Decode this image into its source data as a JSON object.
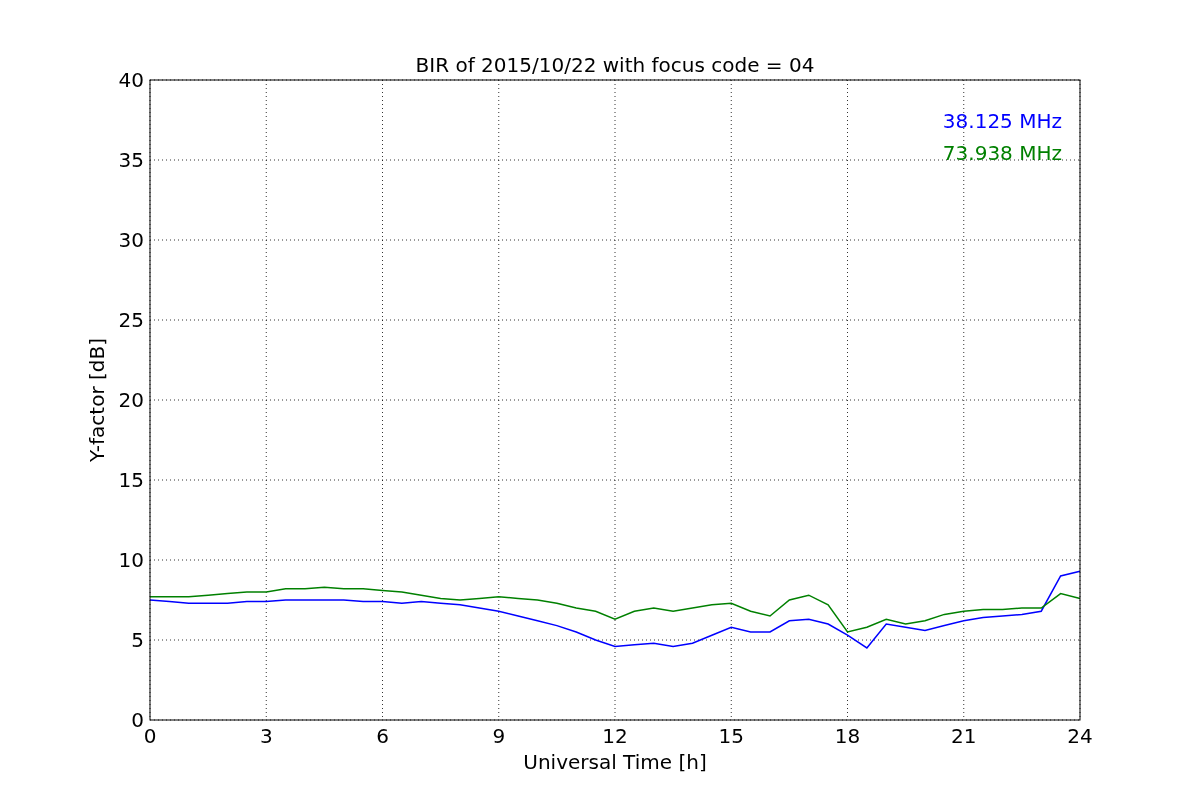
{
  "chart_data": {
    "type": "line",
    "grid": true,
    "title": "BIR of 2015/10/22 with focus code = 04",
    "xlabel": "Universal Time [h]",
    "ylabel": "Y-factor [dB]",
    "x": [
      0,
      0.5,
      1,
      1.5,
      2,
      2.5,
      3,
      3.5,
      4,
      4.5,
      5,
      5.5,
      6,
      6.5,
      7,
      7.5,
      8,
      8.5,
      9,
      9.5,
      10,
      10.5,
      11,
      11.5,
      12,
      12.5,
      13,
      13.5,
      14,
      14.5,
      15,
      15.5,
      16,
      16.5,
      17,
      17.5,
      18,
      18.5,
      19,
      19.5,
      20,
      20.5,
      21,
      21.5,
      22,
      22.5,
      23,
      23.5,
      24
    ],
    "series": [
      {
        "name": "38.125 MHz",
        "color": "#0000ff",
        "values": [
          7.5,
          7.4,
          7.3,
          7.3,
          7.3,
          7.4,
          7.4,
          7.5,
          7.5,
          7.5,
          7.5,
          7.4,
          7.4,
          7.3,
          7.4,
          7.3,
          7.2,
          7.0,
          6.8,
          6.5,
          6.2,
          5.9,
          5.5,
          5.0,
          4.6,
          4.7,
          4.8,
          4.6,
          4.8,
          5.3,
          5.8,
          5.5,
          5.5,
          6.2,
          6.3,
          6.0,
          5.3,
          4.5,
          6.0,
          5.8,
          5.6,
          5.9,
          6.2,
          6.4,
          6.5,
          6.6,
          6.8,
          9.0,
          9.3
        ]
      },
      {
        "name": "73.938 MHz",
        "color": "#008000",
        "values": [
          7.7,
          7.7,
          7.7,
          7.8,
          7.9,
          8.0,
          8.0,
          8.2,
          8.2,
          8.3,
          8.2,
          8.2,
          8.1,
          8.0,
          7.8,
          7.6,
          7.5,
          7.6,
          7.7,
          7.6,
          7.5,
          7.3,
          7.0,
          6.8,
          6.3,
          6.8,
          7.0,
          6.8,
          7.0,
          7.2,
          7.3,
          6.8,
          6.5,
          7.5,
          7.8,
          7.2,
          5.5,
          5.8,
          6.3,
          6.0,
          6.2,
          6.6,
          6.8,
          6.9,
          6.9,
          7.0,
          7.0,
          7.9,
          7.6
        ]
      }
    ],
    "xlim": [
      0,
      24
    ],
    "ylim": [
      0,
      40
    ],
    "xticks": [
      0,
      3,
      6,
      9,
      12,
      15,
      18,
      21,
      24
    ],
    "yticks": [
      0,
      5,
      10,
      15,
      20,
      25,
      30,
      35,
      40
    ]
  }
}
